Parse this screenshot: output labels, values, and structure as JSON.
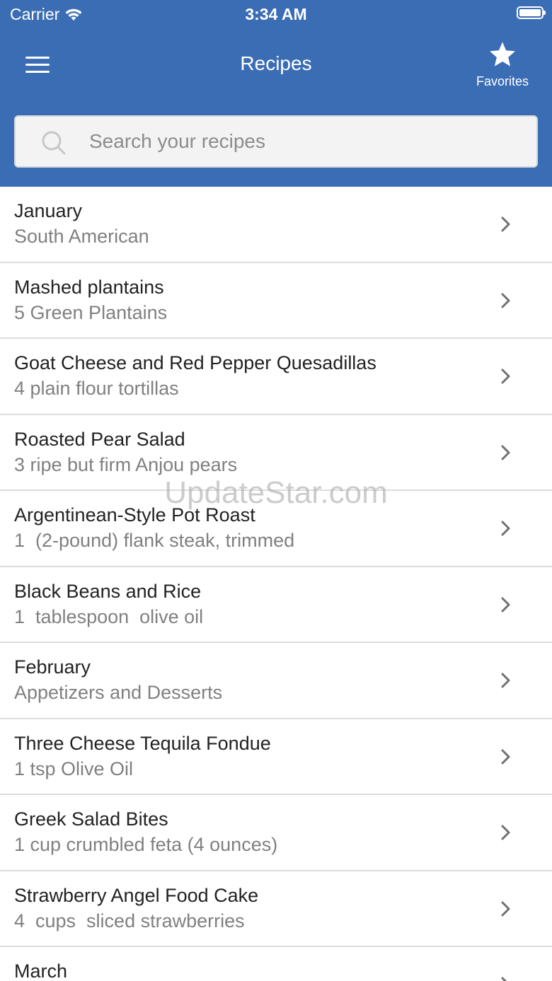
{
  "status_bar": {
    "carrier": "Carrier",
    "time": "3:34 AM"
  },
  "nav": {
    "title": "Recipes",
    "favorites_label": "Favorites",
    "menu_icon": "hamburger-menu-icon",
    "favorites_icon": "star-icon"
  },
  "search": {
    "placeholder": "Search your recipes",
    "value": ""
  },
  "recipes": [
    {
      "title": "January",
      "subtitle": "South American"
    },
    {
      "title": "Mashed plantains",
      "subtitle": "5 Green Plantains"
    },
    {
      "title": "Goat Cheese and Red Pepper Quesadillas",
      "subtitle": "4 plain flour tortillas"
    },
    {
      "title": "Roasted Pear Salad",
      "subtitle": "3 ripe but firm Anjou pears"
    },
    {
      "title": "Argentinean-Style Pot Roast",
      "subtitle": "1  (2-pound) flank steak, trimmed"
    },
    {
      "title": "Black Beans and Rice",
      "subtitle": "1  tablespoon  olive oil"
    },
    {
      "title": "February",
      "subtitle": "Appetizers and Desserts"
    },
    {
      "title": "Three Cheese Tequila Fondue",
      "subtitle": "1 tsp Olive Oil"
    },
    {
      "title": "Greek Salad Bites",
      "subtitle": "1 cup crumbled feta (4 ounces)"
    },
    {
      "title": "Strawberry Angel Food Cake",
      "subtitle": "4  cups  sliced strawberries"
    },
    {
      "title": "March",
      "subtitle": ""
    }
  ],
  "watermark": "UpdateStar.com",
  "colors": {
    "header_bg": "#3b6db4",
    "title_text": "#222222",
    "subtitle_text": "#808080",
    "divider": "#dcdcdc"
  }
}
